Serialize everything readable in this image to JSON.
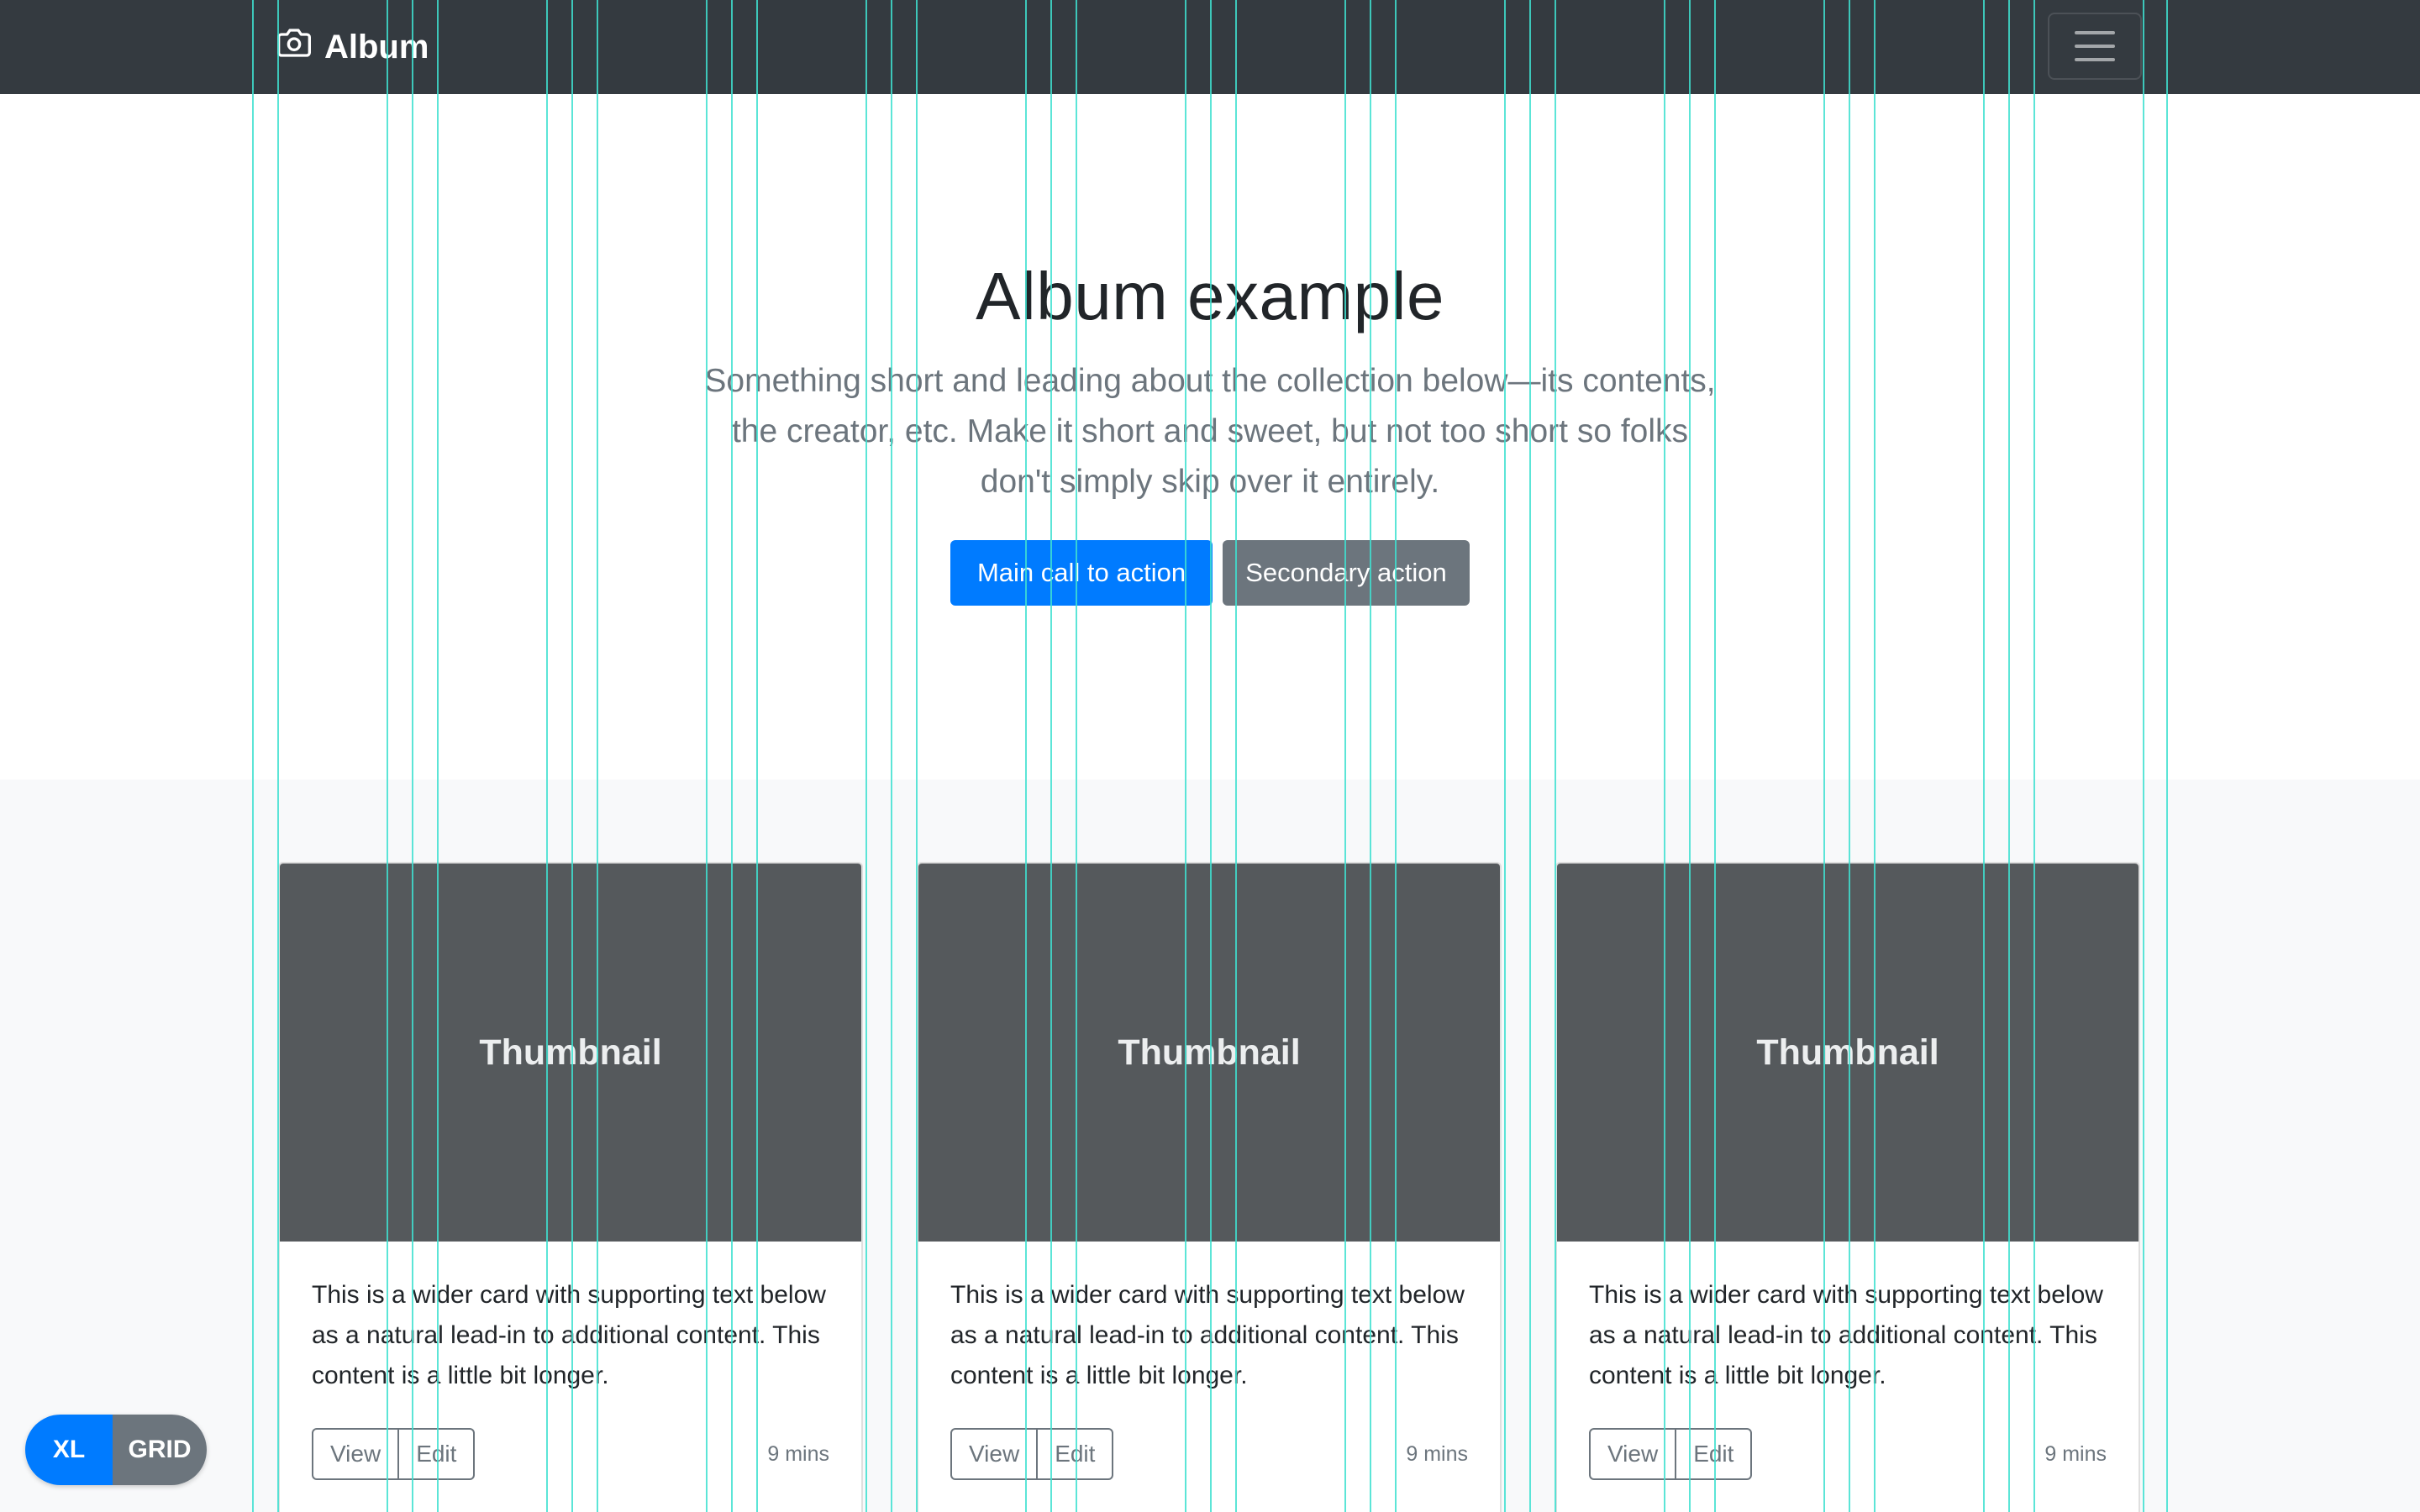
{
  "navbar": {
    "brand": "Album",
    "brand_icon": "camera-icon",
    "toggler_icon": "hamburger-menu-icon"
  },
  "hero": {
    "title": "Album example",
    "lead": "Something short and leading about the collection below—its contents, the creator, etc. Make it short and sweet, but not too short so folks don't simply skip over it entirely.",
    "primary_action": "Main call to action",
    "secondary_action": "Secondary action"
  },
  "cards": [
    {
      "thumbnail": "Thumbnail",
      "text": "This is a wider card with supporting text below as a natural lead-in to additional content. This content is a little bit longer.",
      "view_label": "View",
      "edit_label": "Edit",
      "time": "9 mins"
    },
    {
      "thumbnail": "Thumbnail",
      "text": "This is a wider card with supporting text below as a natural lead-in to additional content. This content is a little bit longer.",
      "view_label": "View",
      "edit_label": "Edit",
      "time": "9 mins"
    },
    {
      "thumbnail": "Thumbnail",
      "text": "This is a wider card with supporting text below as a natural lead-in to additional content. This content is a little bit longer.",
      "view_label": "View",
      "edit_label": "Edit",
      "time": "9 mins"
    }
  ],
  "breakpoint_badge": {
    "size": "XL",
    "mode": "GRID"
  },
  "colors": {
    "navbar": "#343a40",
    "primary": "#007bff",
    "secondary": "#6c757d",
    "thumbnail": "#55595c",
    "grid_line": "#40e0d0"
  }
}
